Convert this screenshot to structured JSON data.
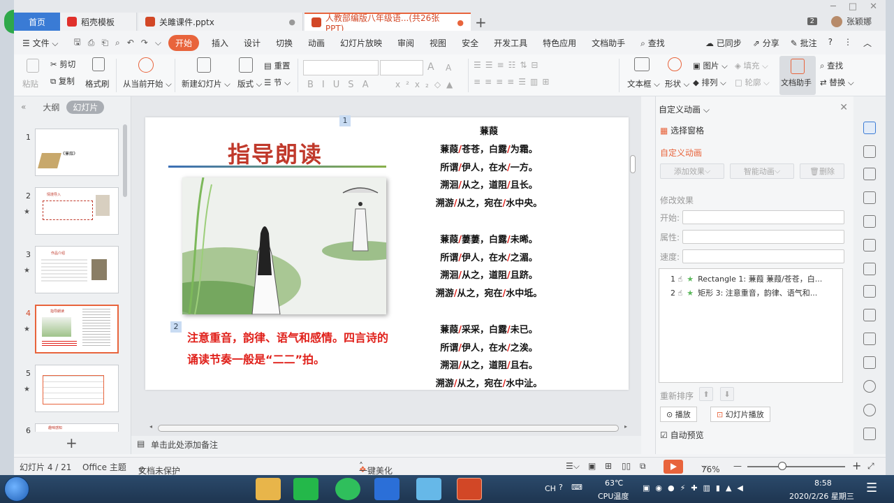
{
  "tabs": {
    "home": "首页",
    "doc1": "稻壳模板",
    "doc2": "关雎课件.pptx",
    "doc3": "人教部编版八年级语...(共26张PPT)",
    "plus": "+",
    "badge": "2",
    "user": "张颖娜"
  },
  "menu": {
    "file": "文件",
    "start": "开始",
    "insert": "插入",
    "design": "设计",
    "switch": "切换",
    "animation": "动画",
    "slideshow": "幻灯片放映",
    "review": "审阅",
    "view": "视图",
    "security": "安全",
    "devtools": "开发工具",
    "special": "特色应用",
    "docassistant": "文档助手",
    "search": "查找",
    "sync": "已同步",
    "share": "分享",
    "comment": "批注",
    "help": "?"
  },
  "ribbon": {
    "paste": "粘贴",
    "cut": "剪切",
    "copy": "复制",
    "formatpainter": "格式刷",
    "fromcurrent": "从当前开始",
    "newslide": "新建幻灯片",
    "layout": "版式",
    "reset": "重置",
    "section": "节",
    "font_a_up": "A",
    "font_a_down": "A",
    "textbox": "文本框",
    "shape": "形状",
    "picture": "图片",
    "fill": "填充",
    "arrange": "排列",
    "outline": "轮廓",
    "docassistant": "文档助手",
    "find": "查找",
    "replace": "替换"
  },
  "leftpane": {
    "outline": "大纲",
    "slides": "幻灯片",
    "thumbs": [
      {
        "num": "1",
        "star": "",
        "caption": "《蒹葭》"
      },
      {
        "num": "2",
        "star": "★",
        "caption": "情境导入"
      },
      {
        "num": "3",
        "star": "★",
        "caption": "作品介绍"
      },
      {
        "num": "4",
        "star": "★",
        "caption": "指导朗读"
      },
      {
        "num": "5",
        "star": "★",
        "caption": ""
      },
      {
        "num": "6",
        "star": "",
        "caption": "趣味感知"
      }
    ],
    "add": "+"
  },
  "slide": {
    "tag1": "1",
    "tag2": "2",
    "title": "指导朗读",
    "note": "注意重音，韵律、语气和感情。四言诗的诵读节奏一般是“二二”拍。",
    "poem_title": "蒹葭",
    "poem": [
      [
        "蒹葭",
        "苍苍，白露",
        "为霜。"
      ],
      [
        "所谓",
        "伊人，在水",
        "一方。"
      ],
      [
        "溯洄",
        "从之，道阻",
        "且长。"
      ],
      [
        "溯游",
        "从之，宛在",
        "水中央。"
      ],
      null,
      [
        "蒹葭",
        "萋萋，白露",
        "未晞。"
      ],
      [
        "所谓",
        "伊人，在水",
        "之湄。"
      ],
      [
        "溯洄",
        "从之，道阻",
        "且跻。"
      ],
      [
        "溯游",
        "从之，宛在",
        "水中坻。"
      ],
      null,
      [
        "蒹葭",
        "采采，白露",
        "未已。"
      ],
      [
        "所谓",
        "伊人，在水",
        "之涘。"
      ],
      [
        "溯洄",
        "从之，道阻",
        "且右。"
      ],
      [
        "溯游",
        "从之，宛在",
        "水中沚。"
      ]
    ]
  },
  "notes": "单击此处添加备注",
  "rightpane": {
    "header": "自定义动画",
    "select_pane": "选择窗格",
    "custom_anim": "自定义动画",
    "add_effect": "添加效果",
    "smart_anim": "智能动画",
    "delete": "删除",
    "modify": "修改效果",
    "start": "开始:",
    "property": "属性:",
    "speed": "速度:",
    "items": [
      {
        "num": "1",
        "label": "Rectangle 1: 蒹葭 蒹葭/苍苍，白..."
      },
      {
        "num": "2",
        "label": "矩形 3: 注意重音，韵律、语气和..."
      }
    ],
    "reorder": "重新排序",
    "play": "播放",
    "slideshow": "幻灯片播放",
    "autopreview": "自动预览"
  },
  "status": {
    "slide_count": "幻灯片 4 / 21",
    "theme": "Office 主题",
    "protect": "文档未保护",
    "beautify": "一键美化",
    "zoom": "76%",
    "minus": "—",
    "plus": "+"
  },
  "taskbar": {
    "lang": "CH",
    "temp": "63℃",
    "temp_label": "CPU温度",
    "time": "8:58",
    "date": "2020/2/26 星期三"
  }
}
